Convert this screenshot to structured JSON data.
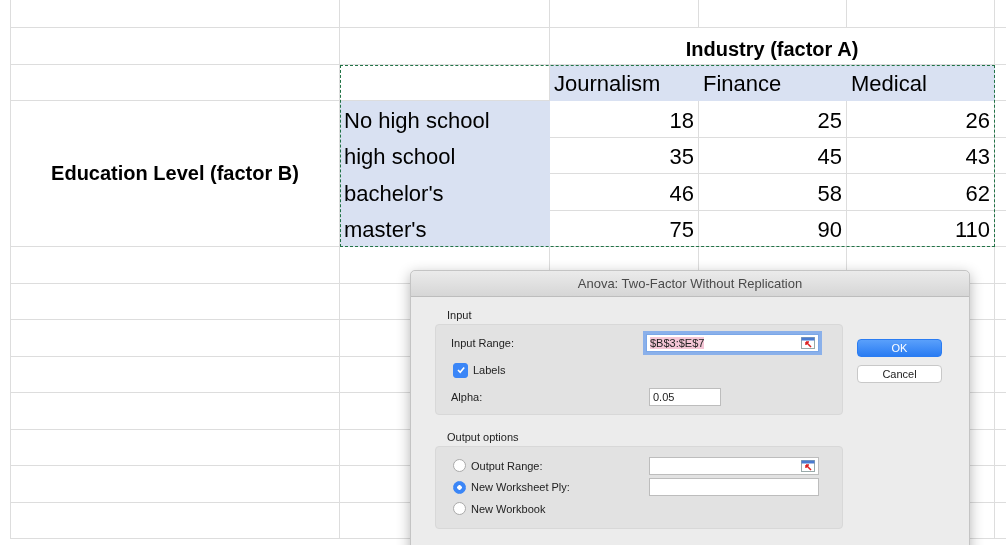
{
  "sheet": {
    "factor_a_title": "Industry (factor A)",
    "factor_b_title": "Education Level (factor B)",
    "columns": [
      "Journalism",
      "Finance",
      "Medical"
    ],
    "rows": [
      {
        "label": "No high school",
        "values": [
          "18",
          "25",
          "26"
        ]
      },
      {
        "label": "high school",
        "values": [
          "35",
          "45",
          "43"
        ]
      },
      {
        "label": "bachelor's",
        "values": [
          "46",
          "58",
          "62"
        ]
      },
      {
        "label": "master's",
        "values": [
          "75",
          "90",
          "110"
        ]
      }
    ]
  },
  "dialog": {
    "title": "Anova: Two-Factor Without Replication",
    "input": {
      "title": "Input",
      "range_label": "Input Range:",
      "range_value": "$B$3:$E$7",
      "labels": {
        "label": "Labels",
        "checked": true
      },
      "alpha_label": "Alpha:",
      "alpha_value": "0.05"
    },
    "output": {
      "title": "Output options",
      "options": [
        {
          "label": "Output Range:",
          "selected": false,
          "kind": "range"
        },
        {
          "label": "New Worksheet Ply:",
          "selected": true,
          "kind": "text"
        },
        {
          "label": "New Workbook",
          "selected": false,
          "kind": "none"
        }
      ]
    },
    "buttons": [
      {
        "label": "OK",
        "kind": "default"
      },
      {
        "label": "Cancel",
        "kind": "plain"
      }
    ]
  }
}
